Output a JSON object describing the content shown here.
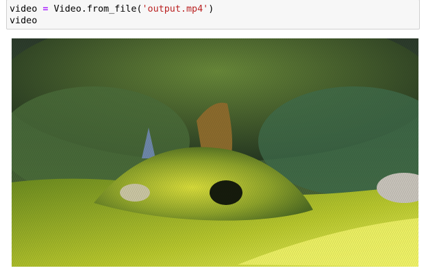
{
  "cell": {
    "line1": {
      "var": "video",
      "op": "=",
      "call": "Video.from_file(",
      "arg": "'output.mp4'",
      "close": ")"
    },
    "line2": "video"
  },
  "output": {
    "media_type": "video",
    "icon": "video-frame-icon"
  },
  "colors": {
    "cell_bg": "#f7f7f7",
    "cell_border": "#cfcfcf",
    "keyword_op": "#aa22ff",
    "string": "#ba2121"
  }
}
